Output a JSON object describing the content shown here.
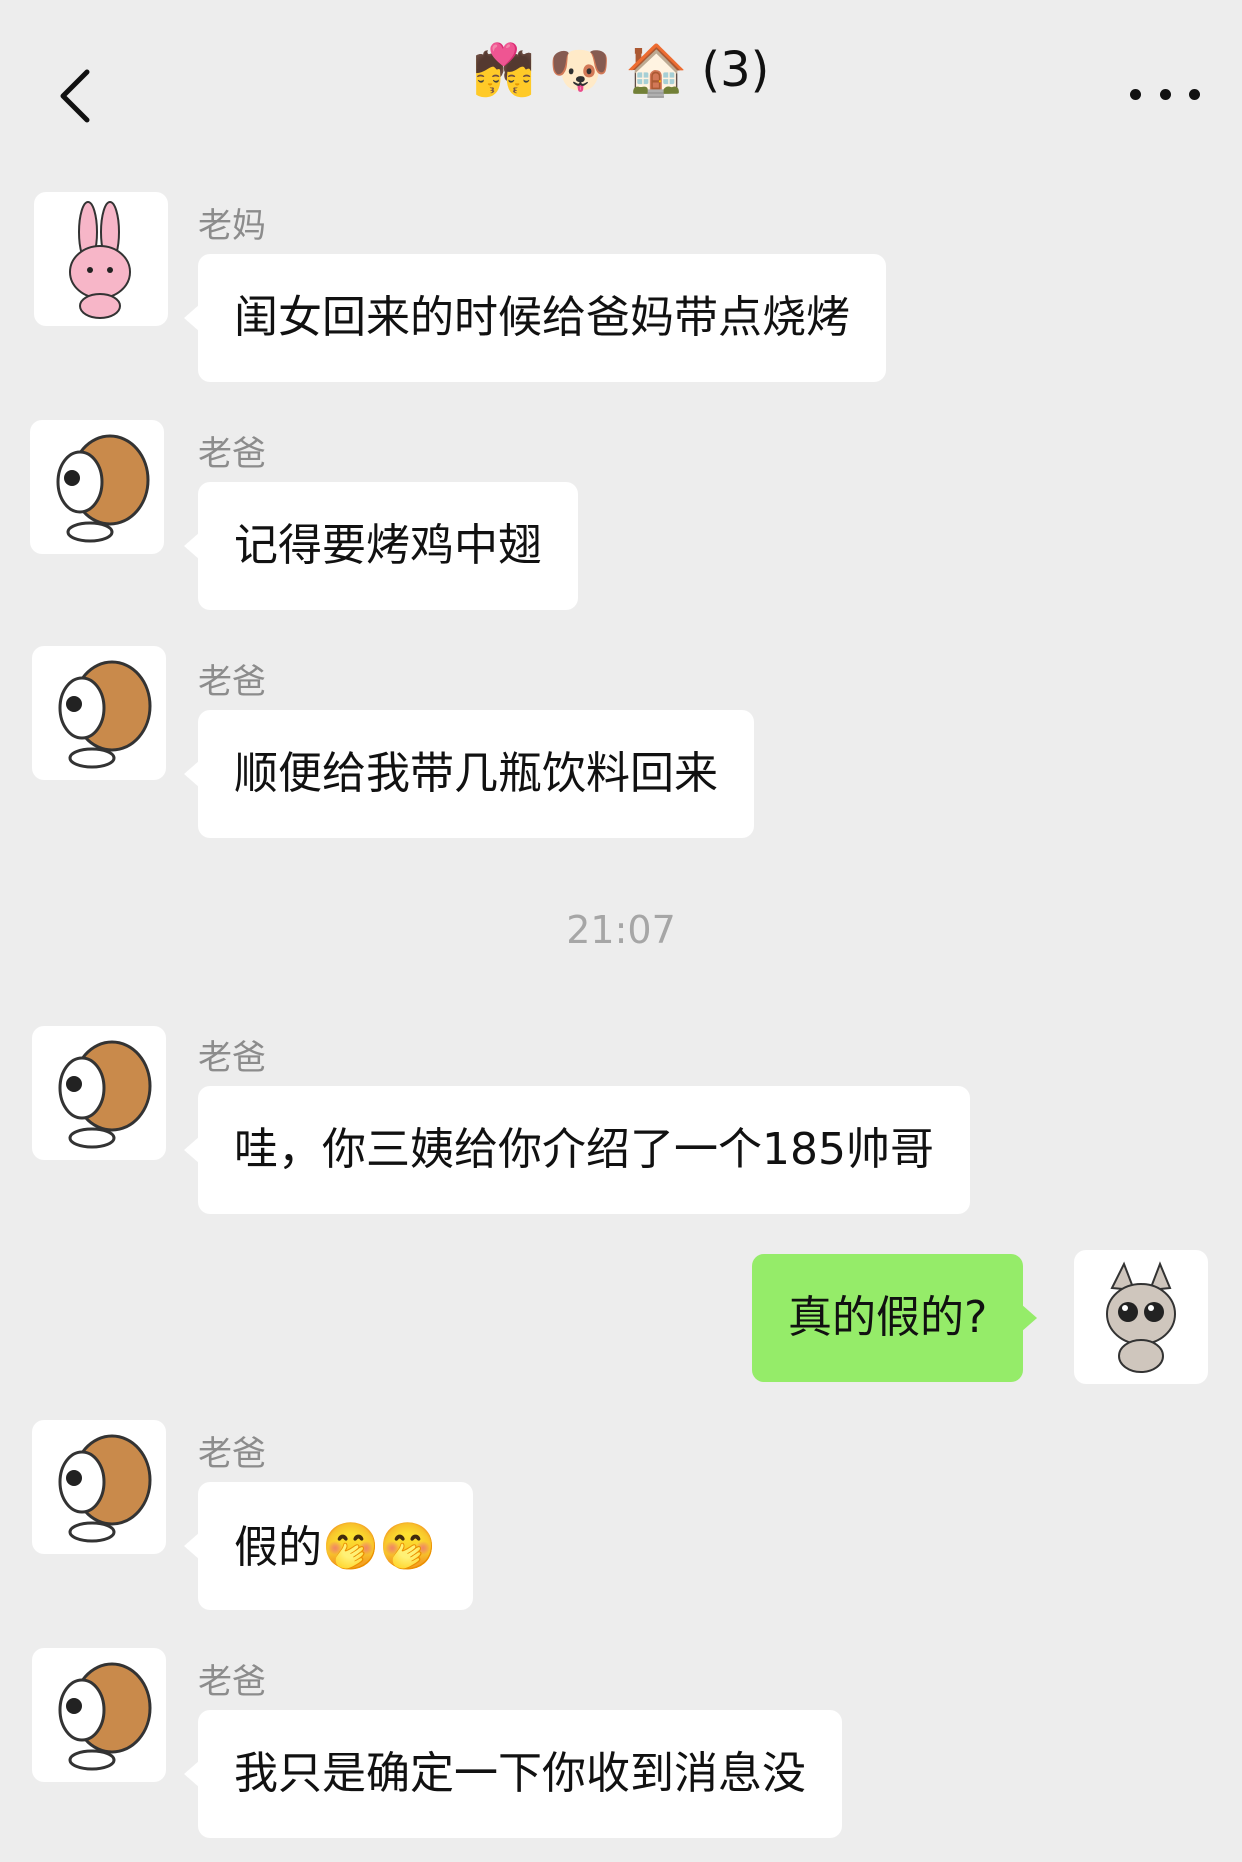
{
  "header": {
    "title_emoji": [
      "💏",
      "🐶",
      "🏠"
    ],
    "member_count": "(3)"
  },
  "messages": [
    {
      "sender": "老妈",
      "text": "闺女回来的时候给爸妈带点烧烤",
      "side": "left",
      "avatar": "pink-bunny-avatar"
    },
    {
      "sender": "老爸",
      "text": "记得要烤鸡中翅",
      "side": "left",
      "avatar": "brown-dog-avatar"
    },
    {
      "sender": "老爸",
      "text": "顺便给我带几瓶饮料回来",
      "side": "left",
      "avatar": "brown-dog-avatar"
    },
    {
      "timestamp": "21:07"
    },
    {
      "sender": "老爸",
      "text": "哇，你三姨给你介绍了一个185帅哥",
      "side": "left",
      "avatar": "brown-dog-avatar"
    },
    {
      "text": "真的假的?",
      "side": "right",
      "avatar": "gray-cat-avatar"
    },
    {
      "sender": "老爸",
      "text": "假的",
      "emoji": [
        "🤭",
        "🤭"
      ],
      "side": "left",
      "avatar": "brown-dog-avatar"
    },
    {
      "sender": "老爸",
      "text": "我只是确定一下你收到消息没",
      "side": "left",
      "avatar": "brown-dog-avatar"
    }
  ],
  "colors": {
    "background": "#ededed",
    "bubble_left": "#ffffff",
    "bubble_right": "#95ec69"
  }
}
